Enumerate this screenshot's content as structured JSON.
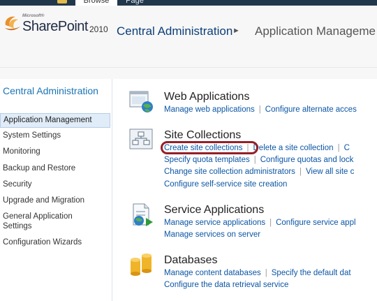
{
  "ribbon": {
    "tabs": [
      "Browse",
      "Page"
    ]
  },
  "header": {
    "logo_microsoft": "Microsoft®",
    "logo_sharepoint": "SharePoint",
    "logo_version": "2010",
    "breadcrumb": [
      "Central Administration",
      "Application Manageme"
    ]
  },
  "nav": {
    "heading": "Central Administration",
    "items": [
      "Application Management",
      "System Settings",
      "Monitoring",
      "Backup and Restore",
      "Security",
      "Upgrade and Migration",
      "General Application Settings",
      "Configuration Wizards"
    ],
    "selected_index": 0
  },
  "sections": {
    "web_applications": {
      "title": "Web Applications",
      "links": [
        "Manage web applications",
        "Configure alternate acces"
      ]
    },
    "site_collections": {
      "title": "Site Collections",
      "row1": [
        "Create site collections",
        "Delete a site collection",
        "C"
      ],
      "row2": [
        "Specify quota templates",
        "Configure quotas and lock"
      ],
      "row3": [
        "Change site collection administrators",
        "View all site c"
      ],
      "row4": [
        "Configure self-service site creation"
      ]
    },
    "service_applications": {
      "title": "Service Applications",
      "row1": [
        "Manage service applications",
        "Configure service appl"
      ],
      "row2": [
        "Manage services on server"
      ]
    },
    "databases": {
      "title": "Databases",
      "row1": [
        "Manage content databases",
        "Specify the default dat"
      ],
      "row2": [
        "Configure the data retrieval service"
      ]
    }
  },
  "colors": {
    "link": "#0c56a5",
    "nav_heading": "#1b74b5",
    "highlight": "#951f26",
    "ribbon": "#21374c"
  }
}
